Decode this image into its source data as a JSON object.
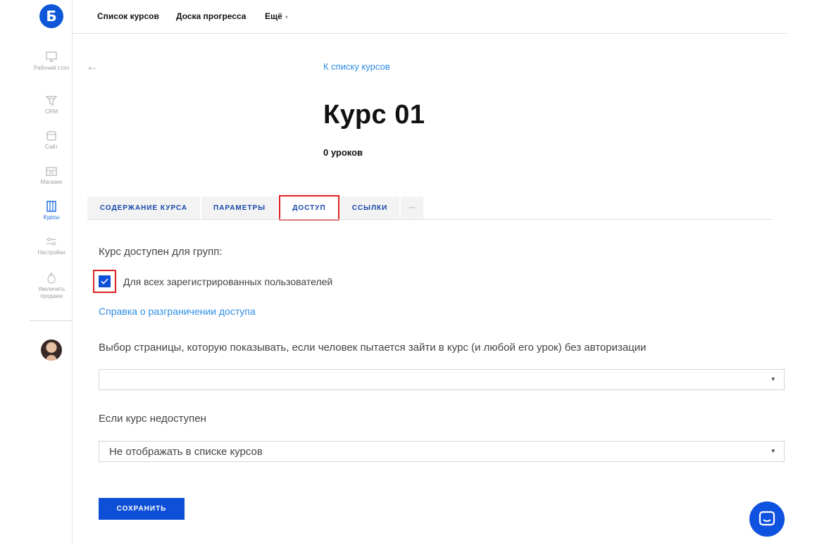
{
  "logo": {
    "letter": "Б"
  },
  "sidebar": {
    "items": [
      {
        "label": "Рабочий стол",
        "icon": "monitor-icon"
      },
      {
        "label": "CRM",
        "icon": "funnel-icon"
      },
      {
        "label": "Сайт",
        "icon": "site-icon"
      },
      {
        "label": "Магазин",
        "icon": "shop-icon"
      },
      {
        "label": "Курсы",
        "icon": "courses-icon",
        "active": true
      },
      {
        "label": "Настройки",
        "icon": "sliders-icon"
      },
      {
        "label": "Увеличить продажи",
        "icon": "flame-icon"
      }
    ]
  },
  "topnav": {
    "courses_list": "Список курсов",
    "progress_board": "Доска прогресса",
    "more": "Ещё",
    "more_caret": "▾"
  },
  "header": {
    "back": "←",
    "breadcrumb": "К списку курсов",
    "title": "Курс 01",
    "lessons": "0 уроков"
  },
  "tabs": [
    {
      "label": "СОДЕРЖАНИЕ КУРСА"
    },
    {
      "label": "ПАРАМЕТРЫ"
    },
    {
      "label": "ДОСТУП",
      "active": true
    },
    {
      "label": "ССЫЛКИ"
    },
    {
      "label": "···"
    }
  ],
  "access": {
    "groups_label": "Курс доступен для групп:",
    "all_registered_label": "Для всех зарегистрированных пользователей",
    "all_registered_checked": true,
    "help_link": "Справка о разграничении доступа",
    "page_select_label": "Выбор страницы, которую показывать, если человек пытается зайти в курс (и любой его урок) без авторизации",
    "page_select_value": "",
    "unavailable_label": "Если курс недоступен",
    "unavailable_value": "Не отображать в списке курсов",
    "caret": "▾"
  },
  "save_button": "СОХРАНИТЬ",
  "colors": {
    "accent": "#0d4fd6",
    "link": "#2d8de6",
    "highlight": "#e02020"
  }
}
